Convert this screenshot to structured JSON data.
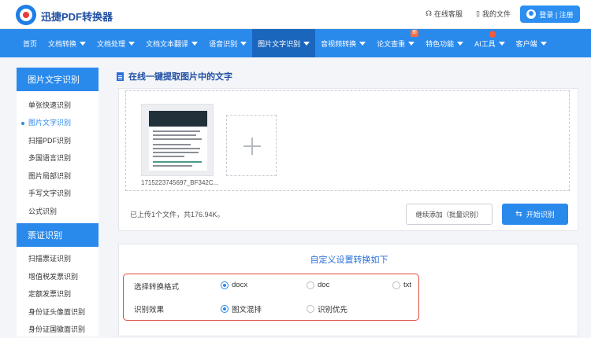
{
  "brand": {
    "name": "迅捷PDF转换器"
  },
  "top_links": {
    "service": "在线客服",
    "my_files": "我的文件"
  },
  "login": {
    "label": "登录 | 注册"
  },
  "nav": {
    "items": [
      {
        "label": "首页",
        "dropdown": false
      },
      {
        "label": "文档转换",
        "dropdown": true
      },
      {
        "label": "文档处理",
        "dropdown": true
      },
      {
        "label": "文档文本翻译",
        "dropdown": true
      },
      {
        "label": "语音识别",
        "dropdown": true
      },
      {
        "label": "图片文字识别",
        "dropdown": true,
        "active": true
      },
      {
        "label": "音视频转换",
        "dropdown": true
      },
      {
        "label": "论文查重",
        "dropdown": true,
        "badge": "新"
      },
      {
        "label": "特色功能",
        "dropdown": true
      },
      {
        "label": "AI工具",
        "dropdown": true,
        "hot": true
      },
      {
        "label": "客户端",
        "dropdown": true
      }
    ]
  },
  "sidebar": {
    "section1_title": "图片文字识别",
    "section1_items": [
      "单张快速识别",
      "图片文字识别",
      "扫描PDF识别",
      "多国语言识别",
      "图片局部识别",
      "手写文字识别",
      "公式识别"
    ],
    "section1_active_index": 1,
    "section2_title": "票证识别",
    "section2_items": [
      "扫描票证识别",
      "增值税发票识别",
      "定额发票识别",
      "身份证头像面识别",
      "身份证国徽面识别"
    ]
  },
  "main": {
    "title": "在线一键提取图片中的文字",
    "file_name": "1715223745697_BF342C...",
    "file_info": "已上传1个文件，共176.94K。",
    "continue_label": "继续添加（批量识别）",
    "start_label": "开始识别"
  },
  "settings": {
    "title": "自定义设置转换如下",
    "format_label": "选择转换格式",
    "format_options": [
      "docx",
      "doc",
      "txt"
    ],
    "format_selected": "docx",
    "effect_label": "识别效果",
    "effect_options": [
      "图文混排",
      "识别优先"
    ],
    "effect_selected": "图文混排"
  },
  "colors": {
    "primary": "#2a8aec",
    "nav_active": "#1b66bd",
    "highlight_border": "#e04a3a"
  }
}
